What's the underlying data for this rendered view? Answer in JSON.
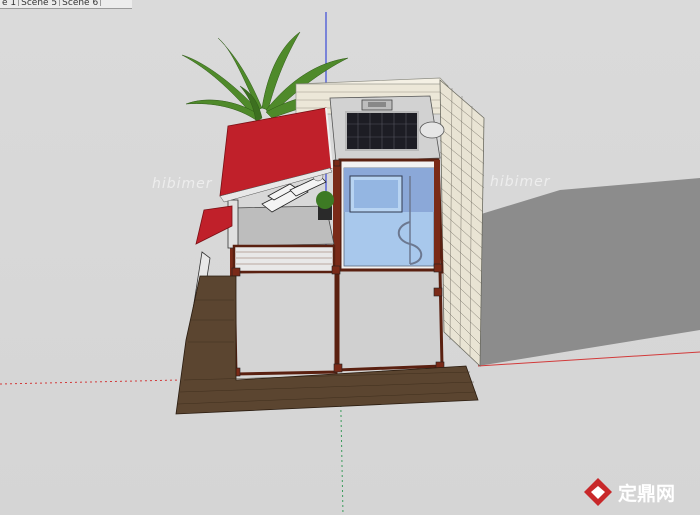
{
  "scene": {
    "tabs": [
      "e 1",
      "Scene 5",
      "Scene 6"
    ],
    "watermarks": [
      "hibimer",
      "hibimer"
    ],
    "site_logo": {
      "text": "定鼎网",
      "icon": "diamond-logo-icon"
    }
  },
  "axes": {
    "red": "#d23a3a",
    "green": "#3a9a5a",
    "blue": "#3a4ad8"
  },
  "colors": {
    "background": "#d8d8d8",
    "shadow": "#8c8c8c",
    "frame": "#7a2a18",
    "awning": "#c0202a",
    "deck": "#5b4530",
    "glass": "#a8c8ec",
    "brick": "#e9e4d4"
  }
}
